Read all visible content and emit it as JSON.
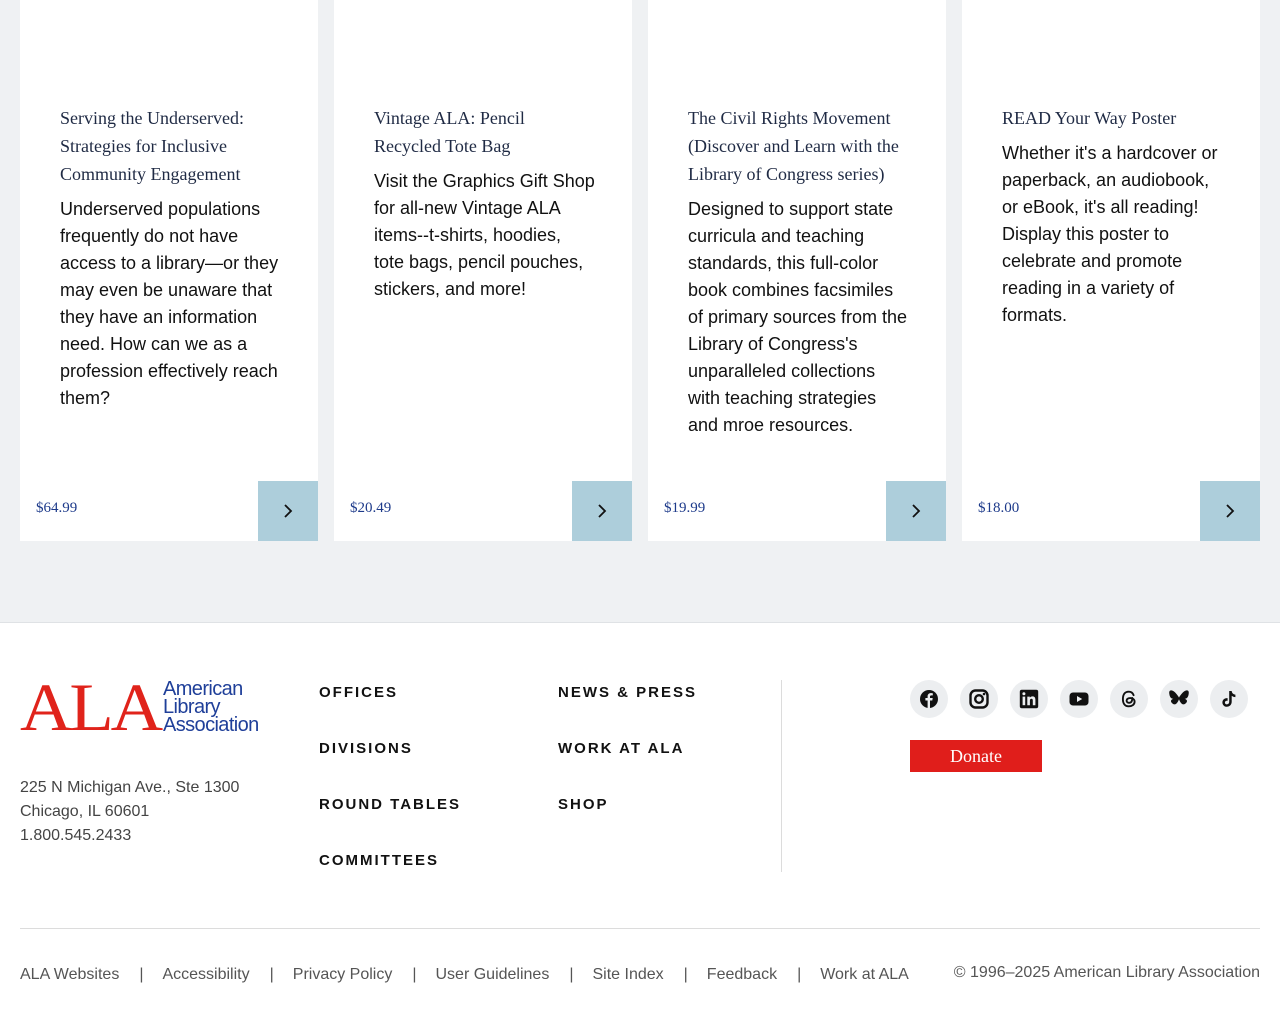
{
  "products": [
    {
      "title": "Serving the Underserved: Strategies for Inclusive Community Engagement",
      "description": "Underserved populations frequently do not have access to a library—or they may even be unaware that they have an information need. How can we as a profession effectively reach them?",
      "price": "$64.99"
    },
    {
      "title": "Vintage ALA: Pencil Recycled Tote Bag",
      "description": "Visit the Graphics Gift Shop for all-new Vintage ALA items--t-shirts, hoodies, tote bags, pencil pouches, stickers, and more!",
      "price": "$20.49"
    },
    {
      "title": "The Civil Rights Movement (Discover and Learn with the Library of Congress series)",
      "description": "Designed to support state curricula and teaching standards, this full-color book combines facsimiles of primary sources from the Library of Congress's unparalleled collections with teaching strategies and mroe resources.",
      "price": "$19.99"
    },
    {
      "title": "READ Your Way Poster",
      "description": "Whether it's a hardcover or paperback, an audiobook, or eBook, it's all reading! Display this poster to celebrate and promote reading in a variety of formats.",
      "price": "$18.00"
    }
  ],
  "footer": {
    "logo": {
      "mark": "ALA",
      "line1": "American",
      "line2": "Library",
      "line3": "Association"
    },
    "address": {
      "street": "225 N Michigan Ave., Ste 1300",
      "city": "Chicago, IL 60601",
      "phone": "1.800.545.2433"
    },
    "nav_col1": [
      "OFFICES",
      "DIVISIONS",
      "ROUND TABLES",
      "COMMITTEES"
    ],
    "nav_col2": [
      "NEWS & PRESS",
      "WORK AT ALA",
      "SHOP"
    ],
    "socials": [
      "facebook-icon",
      "instagram-icon",
      "linkedin-icon",
      "youtube-icon",
      "threads-icon",
      "bluesky-icon",
      "tiktok-icon"
    ],
    "donate_label": "Donate",
    "legal_links": [
      "ALA Websites",
      "Accessibility",
      "Privacy Policy",
      "User Guidelines",
      "Site Index",
      "Feedback",
      "Work at ALA"
    ],
    "legal_separator": "|",
    "copyright": "© 1996–2025 American Library Association"
  },
  "colors": {
    "brand_red": "#e0231b",
    "brand_blue": "#1f3f99",
    "arrow_button": "#adcedb",
    "section_background": "#eff1f3"
  }
}
